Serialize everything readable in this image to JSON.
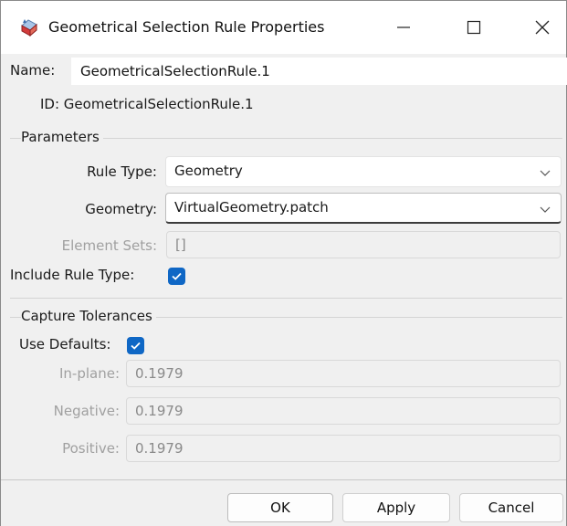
{
  "window": {
    "title": "Geometrical Selection Rule Properties",
    "icon": "selection-rule-app-icon"
  },
  "name": {
    "label": "Name:",
    "value": "GeometricalSelectionRule.1"
  },
  "id": {
    "text": "ID: GeometricalSelectionRule.1"
  },
  "parameters": {
    "title": "Parameters",
    "rule_type": {
      "label": "Rule Type:",
      "value": "Geometry"
    },
    "geometry": {
      "label": "Geometry:",
      "value": "VirtualGeometry.patch"
    },
    "element_sets": {
      "label": "Element Sets:",
      "value": "[]"
    },
    "include_rule_type": {
      "label": "Include Rule Type:",
      "checked": true
    }
  },
  "capture_tolerances": {
    "title": "Capture Tolerances",
    "use_defaults": {
      "label": "Use Defaults:",
      "checked": true
    },
    "in_plane": {
      "label": "In-plane:",
      "value": "0.1979"
    },
    "negative": {
      "label": "Negative:",
      "value": "0.1979"
    },
    "positive": {
      "label": "Positive:",
      "value": "0.1979"
    }
  },
  "buttons": {
    "ok": "OK",
    "apply": "Apply",
    "cancel": "Cancel"
  },
  "colors": {
    "accent": "#0f67c5",
    "background": "#f0f0f0",
    "disabled_text": "#a0a0a0"
  }
}
